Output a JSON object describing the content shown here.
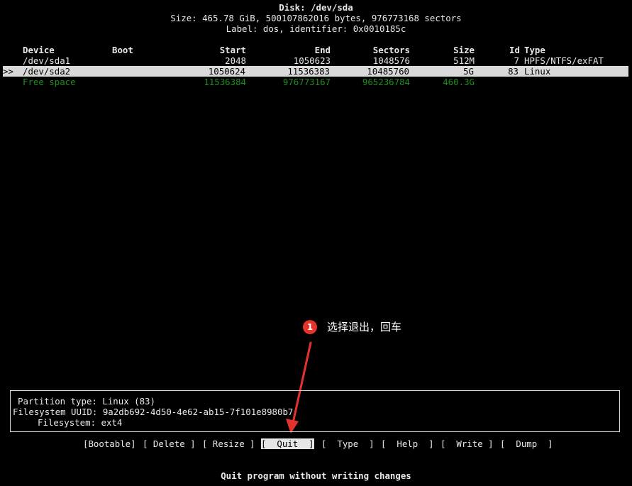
{
  "disk": {
    "title": "Disk: /dev/sda",
    "size_line": "Size: 465.78 GiB, 500107862016 bytes, 976773168 sectors",
    "label_line": "Label: dos, identifier: 0x0010185c"
  },
  "table": {
    "headers": {
      "device": "Device",
      "boot": "Boot",
      "start": "Start",
      "end": "End",
      "sectors": "Sectors",
      "size": "Size",
      "id": "Id",
      "type": "Type"
    },
    "rows": [
      {
        "marker": "",
        "device": "/dev/sda1",
        "boot": "",
        "start": "2048",
        "end": "1050623",
        "sectors": "1048576",
        "size": "512M",
        "id": "7",
        "type": "HPFS/NTFS/exFAT"
      },
      {
        "marker": ">>",
        "device": "/dev/sda2",
        "boot": "",
        "start": "1050624",
        "end": "11536383",
        "sectors": "10485760",
        "size": "5G",
        "id": "83",
        "type": "Linux"
      },
      {
        "marker": "",
        "device": "Free space",
        "boot": "",
        "start": "11536384",
        "end": "976773167",
        "sectors": "965236784",
        "size": "460.3G",
        "id": "",
        "type": ""
      }
    ]
  },
  "info": {
    "partition_type": "Partition type: Linux (83)",
    "filesystem_uuid": "Filesystem UUID: 9a2db692-4d50-4e62-ab15-7f101e8980b7",
    "filesystem": "Filesystem: ext4"
  },
  "menu": {
    "bootable": "[Bootable]",
    "delete": "[ Delete ]",
    "resize": "[ Resize ]",
    "quit": "[  Quit  ]",
    "type": "[  Type  ]",
    "help": "[  Help  ]",
    "write": "[  Write ]",
    "dump": "[  Dump  ]"
  },
  "status": "Quit program without writing changes",
  "annotation": {
    "number": "1",
    "text": "选择退出，回车"
  },
  "colors": {
    "background": "#000000",
    "selected_row": "#d9d9d9",
    "free_space": "#1f8b1f",
    "annotation": "#e5322d"
  }
}
